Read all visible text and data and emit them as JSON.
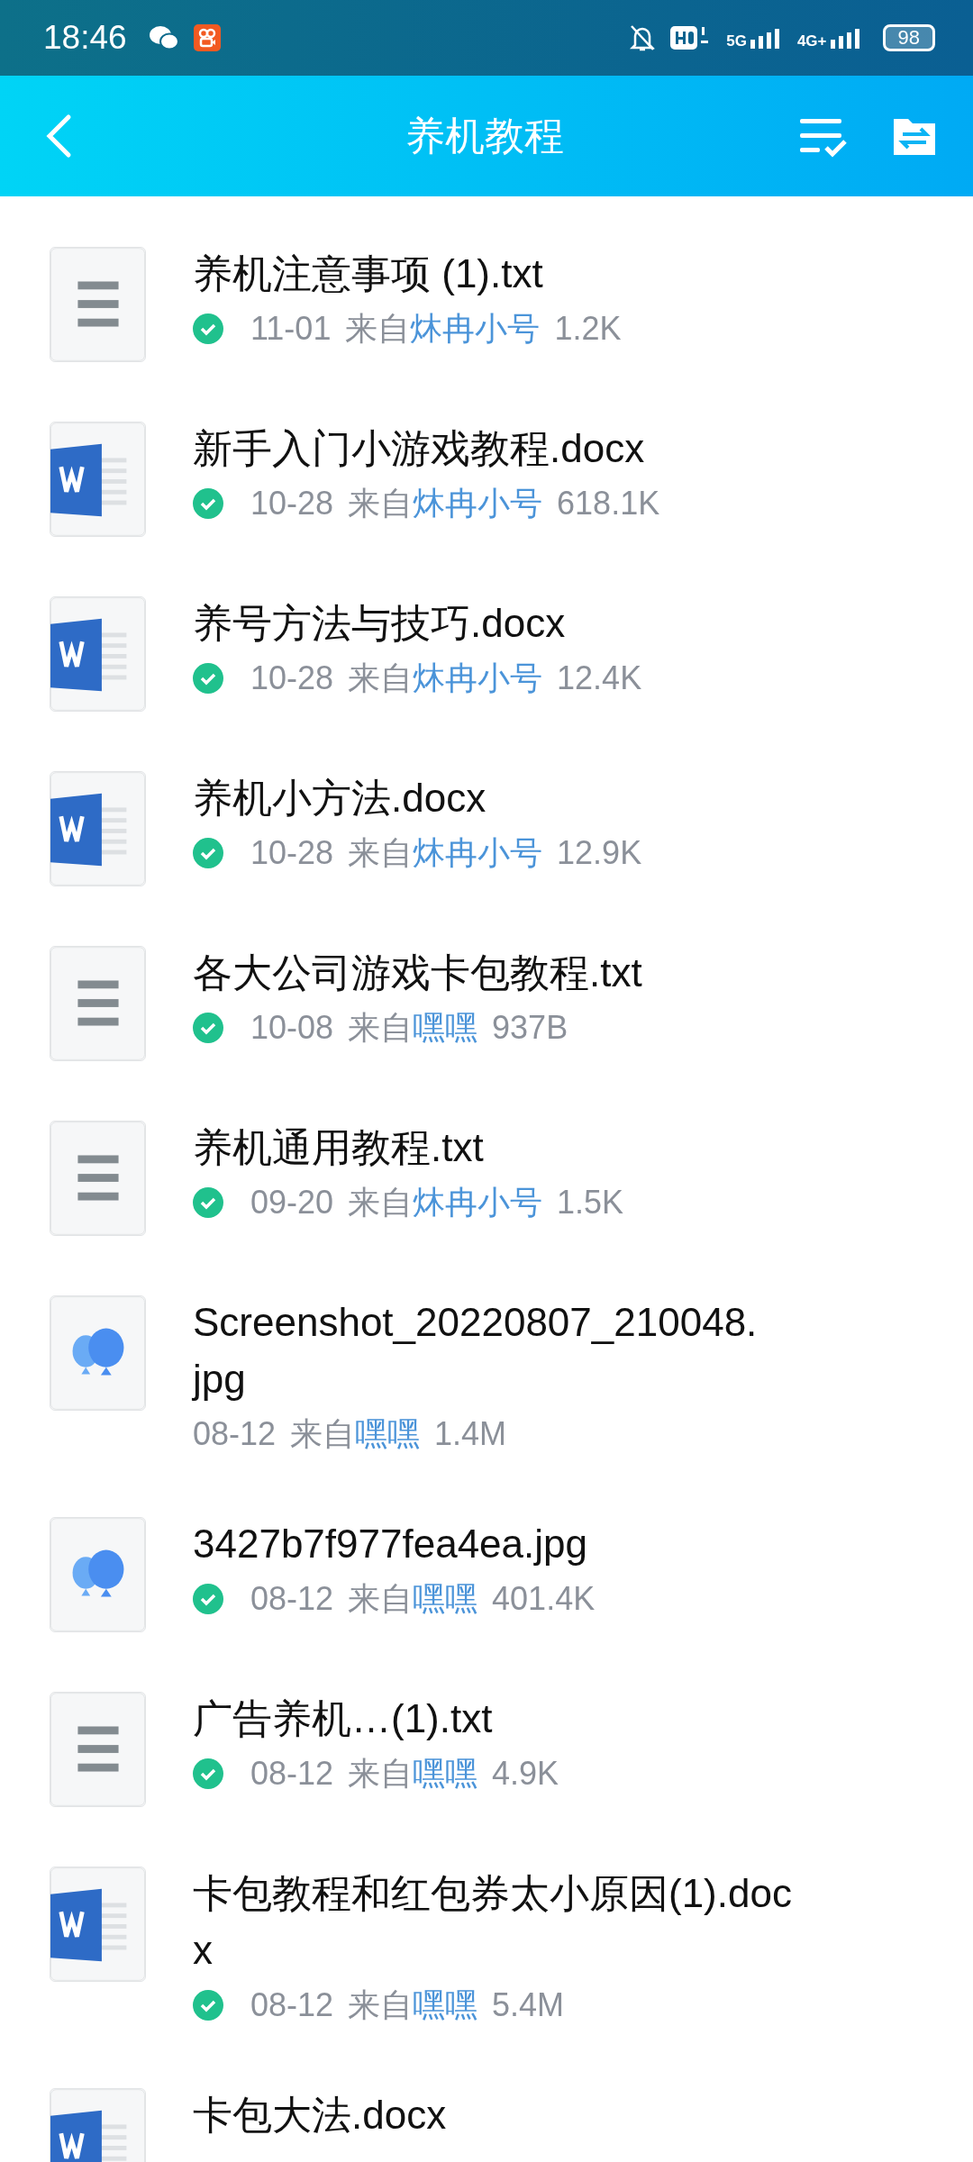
{
  "status_bar": {
    "time": "18:46",
    "network_1": "5G",
    "network_2": "4G+",
    "battery": "98"
  },
  "header": {
    "title": "养机教程"
  },
  "files": [
    {
      "kind": "txt",
      "title_lines": [
        "养机注意事项 (1).txt"
      ],
      "synced": true,
      "date": "11-01",
      "source_label": "来自",
      "sender": "炑冉小号",
      "size": "1.2K"
    },
    {
      "kind": "word",
      "title_lines": [
        "新手入门小游戏教程.docx"
      ],
      "synced": true,
      "date": "10-28",
      "source_label": "来自",
      "sender": "炑冉小号",
      "size": "618.1K"
    },
    {
      "kind": "word",
      "title_lines": [
        "养号方法与技巧.docx"
      ],
      "synced": true,
      "date": "10-28",
      "source_label": "来自",
      "sender": "炑冉小号",
      "size": "12.4K"
    },
    {
      "kind": "word",
      "title_lines": [
        "养机小方法.docx"
      ],
      "synced": true,
      "date": "10-28",
      "source_label": "来自",
      "sender": "炑冉小号",
      "size": "12.9K"
    },
    {
      "kind": "txt",
      "title_lines": [
        "各大公司游戏卡包教程.txt"
      ],
      "synced": true,
      "date": "10-08",
      "source_label": "来自",
      "sender": "嘿嘿",
      "size": "937B"
    },
    {
      "kind": "txt",
      "title_lines": [
        "养机通用教程.txt"
      ],
      "synced": true,
      "date": "09-20",
      "source_label": "来自",
      "sender": "炑冉小号",
      "size": "1.5K"
    },
    {
      "kind": "image",
      "title_lines": [
        "Screenshot_20220807_210048.",
        "jpg"
      ],
      "synced": false,
      "date": "08-12",
      "source_label": "来自",
      "sender": "嘿嘿",
      "size": "1.4M"
    },
    {
      "kind": "image",
      "title_lines": [
        "3427b7f977fea4ea.jpg"
      ],
      "synced": true,
      "date": "08-12",
      "source_label": "来自",
      "sender": "嘿嘿",
      "size": "401.4K"
    },
    {
      "kind": "txt",
      "title_lines": [
        "广告养机…(1).txt"
      ],
      "synced": true,
      "date": "08-12",
      "source_label": "来自",
      "sender": "嘿嘿",
      "size": "4.9K"
    },
    {
      "kind": "word",
      "title_lines": [
        "卡包教程和红包券太小原因(1).doc",
        "x"
      ],
      "synced": true,
      "date": "08-12",
      "source_label": "来自",
      "sender": "嘿嘿",
      "size": "5.4M"
    },
    {
      "kind": "word",
      "title_lines": [
        "卡包大法.docx"
      ]
    }
  ]
}
